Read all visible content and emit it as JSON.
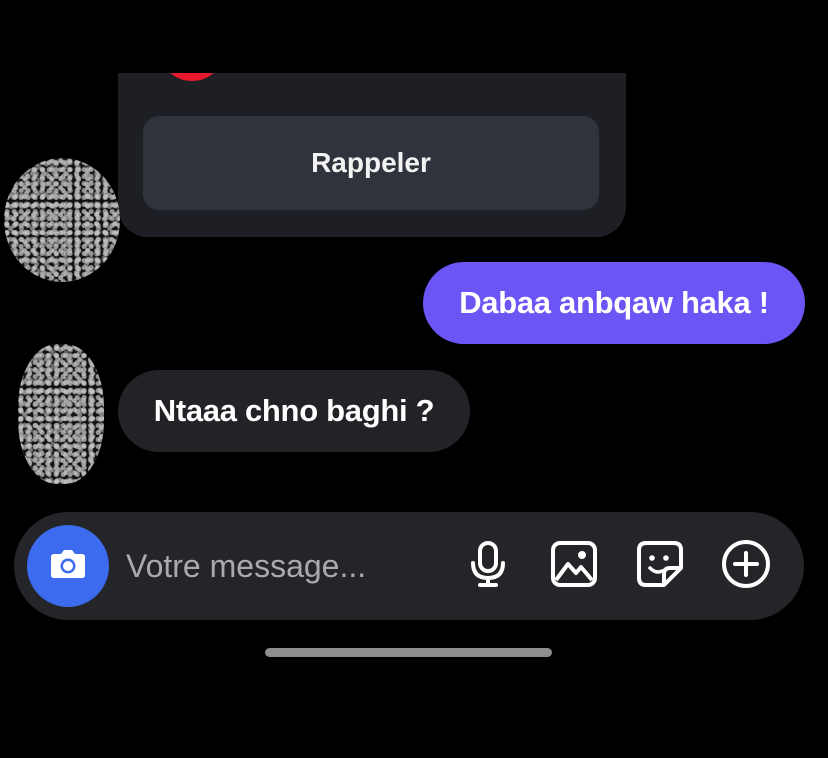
{
  "call_card": {
    "recall_label": "Rappeler",
    "indicator_color": "#e8192c"
  },
  "messages": [
    {
      "direction": "outgoing",
      "text": "Dabaa anbqaw haka !"
    },
    {
      "direction": "incoming",
      "text": "Ntaaa chno baghi ?"
    }
  ],
  "composer": {
    "placeholder": "Votre message...",
    "value": "",
    "icons": [
      "camera-icon",
      "microphone-icon",
      "image-icon",
      "sticker-icon",
      "plus-icon"
    ]
  },
  "colors": {
    "outgoing_bubble": "#6b55f4",
    "incoming_bubble": "#222327",
    "camera_button": "#3d6bf0"
  }
}
